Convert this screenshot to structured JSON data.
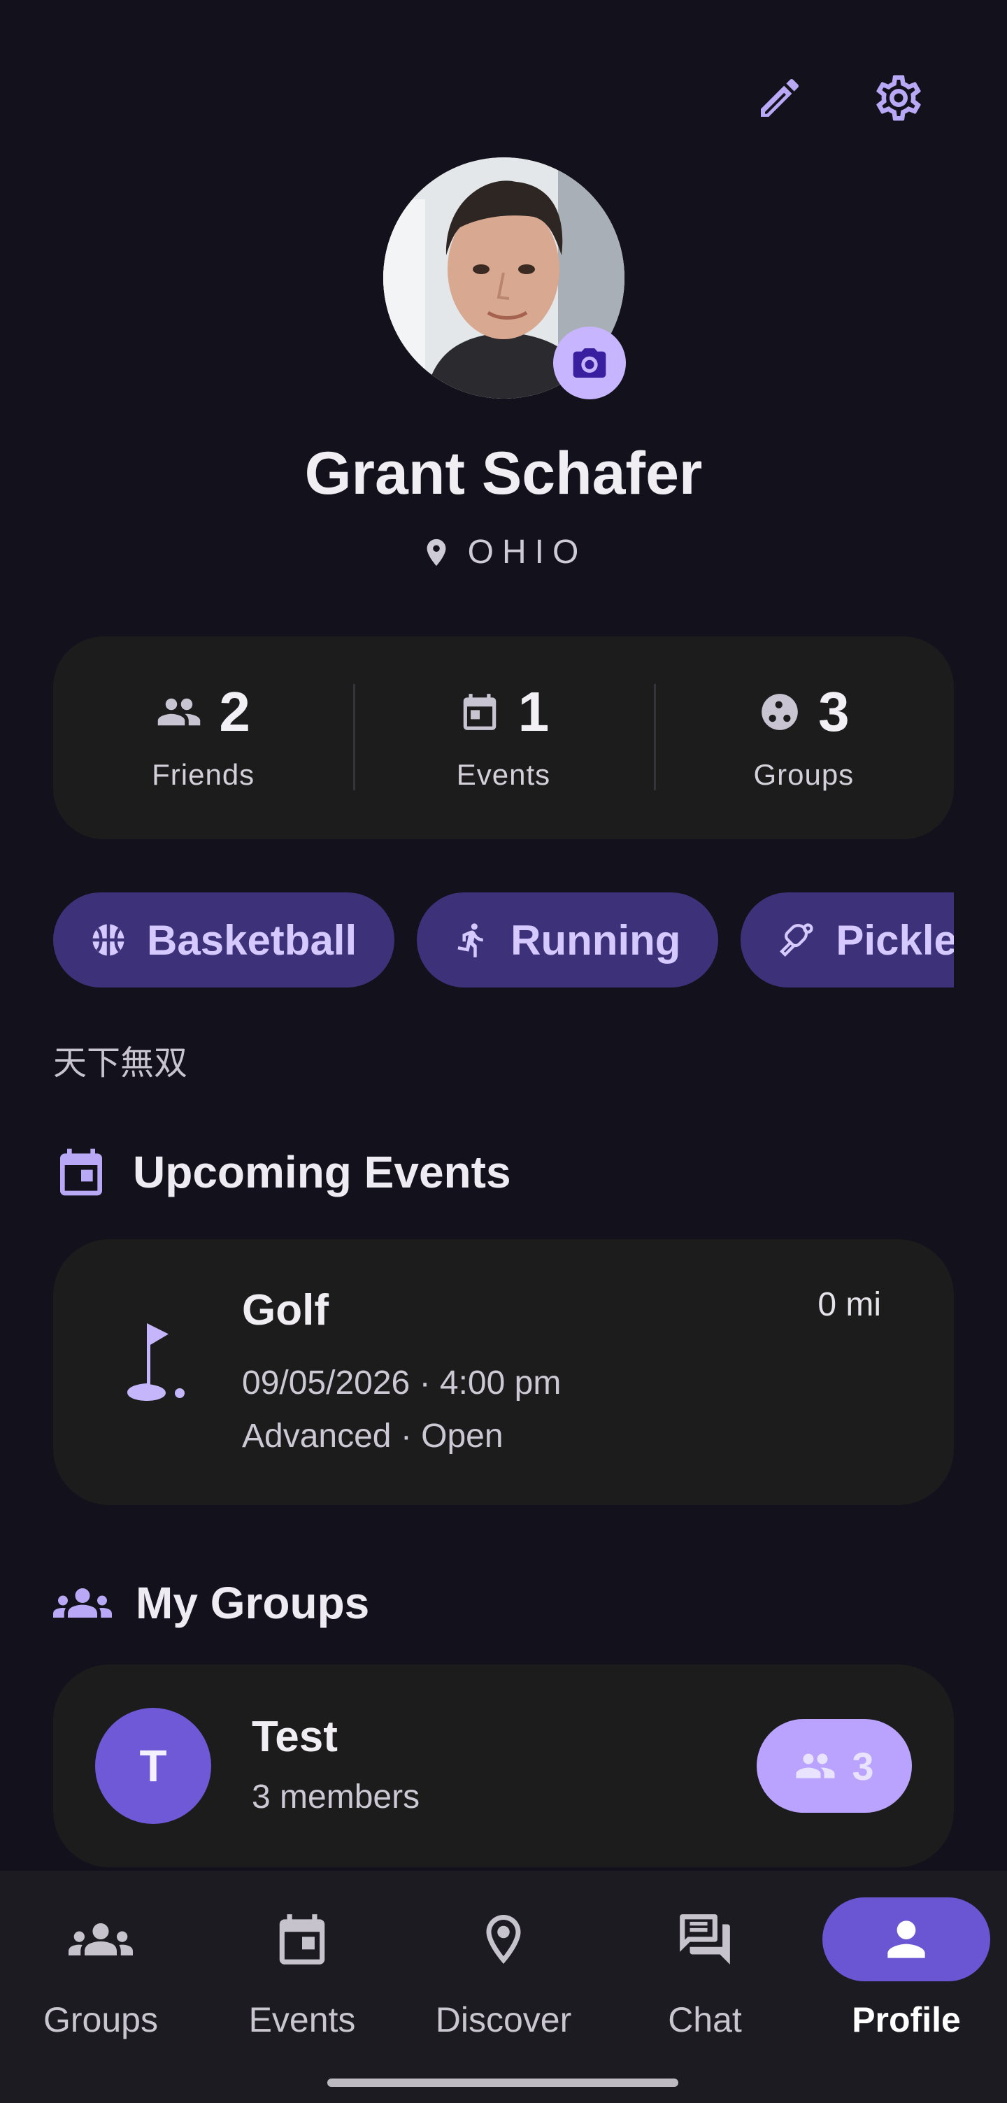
{
  "header": {
    "edit_icon": "pencil-icon",
    "settings_icon": "gear-icon"
  },
  "profile": {
    "name": "Grant Schafer",
    "location": "OHIO",
    "location_icon": "map-pin-icon",
    "avatar_alt": "profile photo",
    "camera_icon": "camera-icon"
  },
  "stats": [
    {
      "icon": "friends-icon",
      "value": "2",
      "label": "Friends"
    },
    {
      "icon": "calendar-icon",
      "value": "1",
      "label": "Events"
    },
    {
      "icon": "groups-icon",
      "value": "3",
      "label": "Groups"
    }
  ],
  "sports": [
    {
      "icon": "basketball-icon",
      "label": "Basketball"
    },
    {
      "icon": "running-icon",
      "label": "Running"
    },
    {
      "icon": "pickleball-icon",
      "label": "Pickleball"
    }
  ],
  "bio": "天下無双",
  "upcoming": {
    "title": "Upcoming Events",
    "icon": "calendar-icon",
    "events": [
      {
        "icon": "golf-icon",
        "title": "Golf",
        "distance": "0 mi",
        "datetime": "09/05/2026 · 4:00 pm",
        "details": "Advanced · Open"
      }
    ]
  },
  "my_groups": {
    "title": "My Groups",
    "icon": "groups-icon",
    "groups": [
      {
        "initial": "T",
        "name": "Test",
        "members": "3 members",
        "count": "3"
      }
    ]
  },
  "nav": [
    {
      "icon": "groups-icon",
      "label": "Groups",
      "active": false
    },
    {
      "icon": "calendar-icon",
      "label": "Events",
      "active": false
    },
    {
      "icon": "map-pin-icon",
      "label": "Discover",
      "active": false
    },
    {
      "icon": "chat-icon",
      "label": "Chat",
      "active": false
    },
    {
      "icon": "person-icon",
      "label": "Profile",
      "active": true
    }
  ],
  "colors": {
    "background": "#13121c",
    "card": "#1c1c1d",
    "accent": "#b9a8f5",
    "chip_bg": "#3d3279",
    "active_nav": "#6a55d2"
  }
}
